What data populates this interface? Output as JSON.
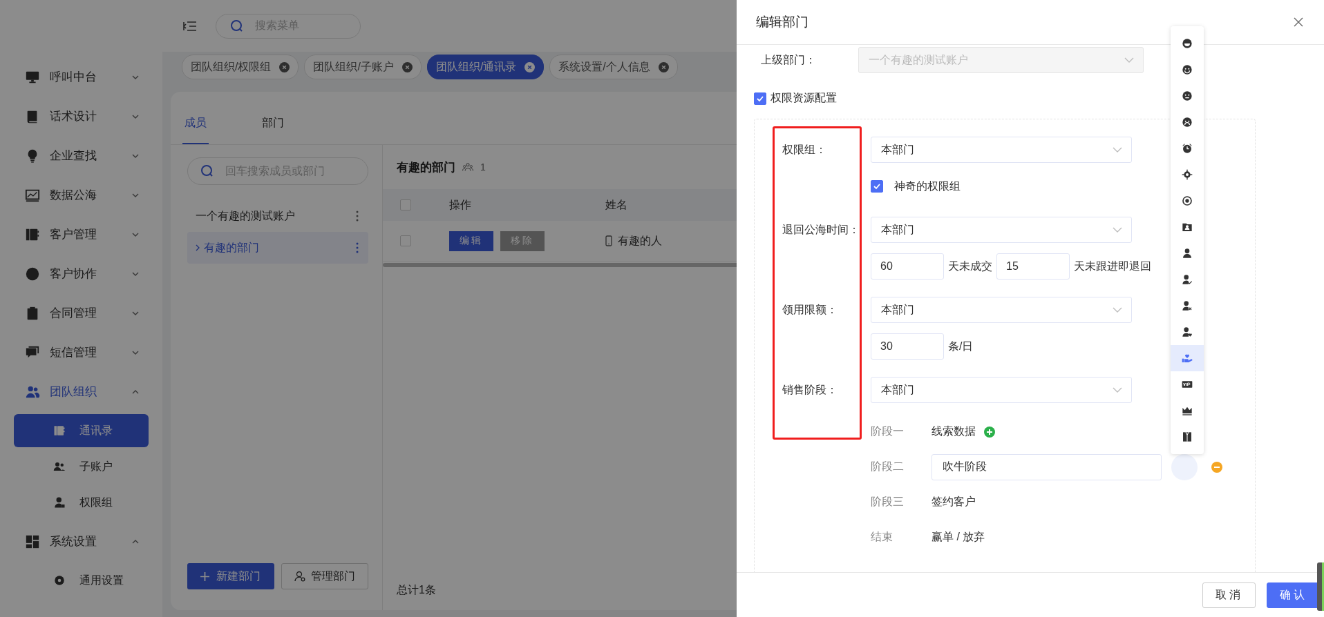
{
  "sidebar": {
    "items": [
      {
        "label": "呼叫中台",
        "selected": false,
        "expanded": false
      },
      {
        "label": "话术设计",
        "selected": false,
        "expanded": false
      },
      {
        "label": "企业查找",
        "selected": false,
        "expanded": false
      },
      {
        "label": "数据公海",
        "selected": false,
        "expanded": false
      },
      {
        "label": "客户管理",
        "selected": false,
        "expanded": false
      },
      {
        "label": "客户协作",
        "selected": false,
        "expanded": false
      },
      {
        "label": "合同管理",
        "selected": false,
        "expanded": false
      },
      {
        "label": "短信管理",
        "selected": false,
        "expanded": false
      },
      {
        "label": "团队组织",
        "selected": true,
        "expanded": true,
        "children": [
          {
            "label": "通讯录",
            "selected": true
          },
          {
            "label": "子账户",
            "selected": false
          },
          {
            "label": "权限组",
            "selected": false
          }
        ]
      },
      {
        "label": "系统设置",
        "selected": false,
        "expanded": true,
        "children": [
          {
            "label": "通用设置",
            "selected": false
          }
        ]
      }
    ]
  },
  "header": {
    "search_placeholder": "搜索菜单"
  },
  "tabs": [
    {
      "label": "团队组织/权限组",
      "selected": false
    },
    {
      "label": "团队组织/子账户",
      "selected": false
    },
    {
      "label": "团队组织/通讯录",
      "selected": true
    },
    {
      "label": "系统设置/个人信息",
      "selected": false
    }
  ],
  "page": {
    "tabs": [
      {
        "label": "成员",
        "selected": true
      },
      {
        "label": "部门",
        "selected": false
      }
    ],
    "search_placeholder": "回车搜索成员或部门",
    "tree": [
      {
        "label": "一个有趣的测试账户",
        "selected": false,
        "children": [
          {
            "label": "有趣的部门",
            "selected": true,
            "expanded": false
          }
        ]
      }
    ],
    "buttons": [
      "新建部门",
      "管理部门"
    ],
    "department": {
      "title": "有趣的部门",
      "count": "1"
    },
    "table": {
      "header_checked": false,
      "columns": [
        "操作",
        "姓名"
      ],
      "rows": [
        {
          "checked": false,
          "actions": [
            "编辑",
            "移除"
          ],
          "name": "有趣的人"
        }
      ]
    },
    "total": "总计1条"
  },
  "drawer": {
    "title": "编辑部门",
    "parent": {
      "label": "上级部门：",
      "value": "一个有趣的测试账户",
      "disabled": true
    },
    "resource": {
      "label": "权限资源配置",
      "checked": true
    },
    "fields": [
      {
        "kind": "checkbox",
        "label": "权限组：",
        "select": "本部门",
        "option": {
          "label": "神奇的权限组",
          "checked": true
        }
      },
      {
        "kind": "days",
        "label": "退回公海时间：",
        "select": "本部门",
        "values": [
          "60",
          "15"
        ],
        "units": [
          "天未成交",
          "天未跟进即退回"
        ]
      },
      {
        "kind": "quota",
        "label": "领用限额：",
        "select": "本部门",
        "values": [
          "30"
        ],
        "units": [
          "条/日"
        ]
      },
      {
        "kind": "stages",
        "label": "销售阶段：",
        "select": "本部门"
      }
    ],
    "stages": [
      {
        "kind": "text",
        "label": "阶段一",
        "value": "线索数据",
        "addable": true
      },
      {
        "kind": "input",
        "label": "阶段二",
        "value": "吹牛阶段",
        "removable": true
      },
      {
        "kind": "text",
        "label": "阶段三",
        "value": "签约客户"
      },
      {
        "kind": "text",
        "label": "结束",
        "value": "赢单 / 放弃"
      }
    ],
    "icon_picker": {
      "items": [
        {
          "selected": false
        },
        {
          "selected": false
        },
        {
          "selected": false
        },
        {
          "selected": false
        },
        {
          "selected": false
        },
        {
          "selected": false
        },
        {
          "selected": false
        },
        {
          "selected": false
        },
        {
          "selected": false
        },
        {
          "selected": false
        },
        {
          "selected": false
        },
        {
          "selected": false
        },
        {
          "selected": true
        },
        {
          "selected": false
        },
        {
          "selected": false
        },
        {
          "selected": false
        }
      ]
    },
    "buttons": [
      {
        "kind": "default",
        "label": "取消"
      },
      {
        "kind": "primary",
        "label": "确认"
      }
    ]
  }
}
